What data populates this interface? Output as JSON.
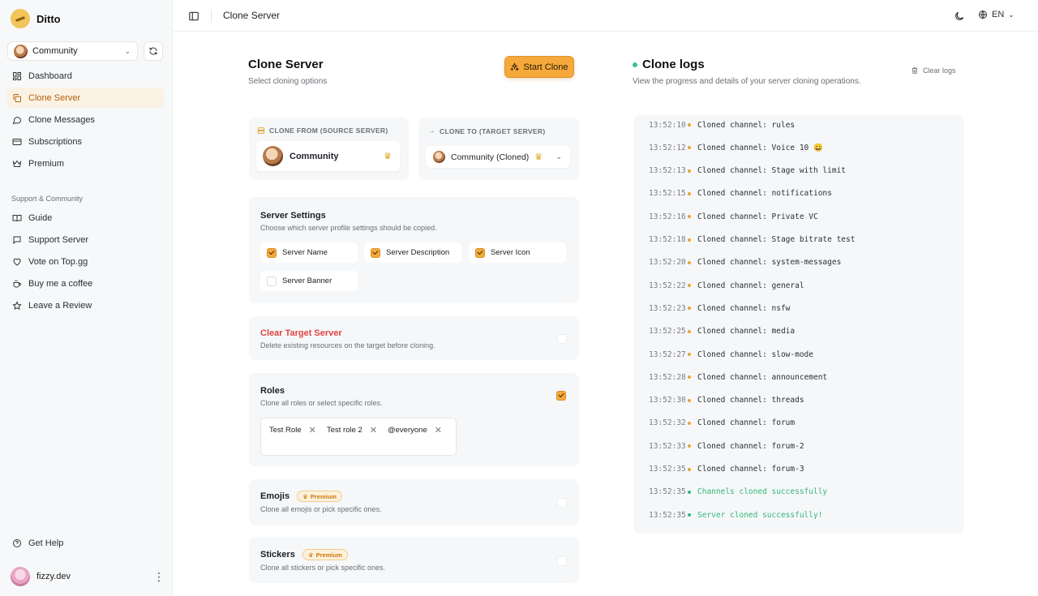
{
  "app": {
    "name": "Ditto"
  },
  "sidebar": {
    "server_selector": {
      "value": "Community"
    },
    "nav": [
      {
        "label": "Dashboard",
        "icon": "dashboard-icon",
        "active": false
      },
      {
        "label": "Clone Server",
        "icon": "copy-icon",
        "active": true
      },
      {
        "label": "Clone Messages",
        "icon": "message-icon",
        "active": false
      },
      {
        "label": "Subscriptions",
        "icon": "card-icon",
        "active": false
      },
      {
        "label": "Premium",
        "icon": "crown-icon",
        "active": false
      }
    ],
    "section_title": "Support & Community",
    "support_nav": [
      {
        "label": "Guide",
        "icon": "book-icon"
      },
      {
        "label": "Support Server",
        "icon": "chat-icon"
      },
      {
        "label": "Vote on Top.gg",
        "icon": "heart-icon"
      },
      {
        "label": "Buy me a coffee",
        "icon": "coffee-icon"
      },
      {
        "label": "Leave a Review",
        "icon": "star-icon"
      }
    ],
    "help": "Get Help",
    "user": {
      "name": "fizzy.dev"
    }
  },
  "topbar": {
    "title": "Clone Server",
    "language": "EN"
  },
  "main": {
    "title": "Clone Server",
    "subtitle": "Select cloning options",
    "start_button": "Start Clone",
    "source": {
      "label": "CLONE FROM (SOURCE SERVER)",
      "server": "Community"
    },
    "target": {
      "label": "CLONE TO (TARGET SERVER)",
      "server": "Community (Cloned)"
    },
    "server_settings": {
      "title": "Server Settings",
      "subtitle": "Choose which server profile settings should be copied.",
      "options": [
        {
          "label": "Server Name",
          "checked": true
        },
        {
          "label": "Server Description",
          "checked": true
        },
        {
          "label": "Server Icon",
          "checked": true
        },
        {
          "label": "Server Banner",
          "checked": false
        }
      ]
    },
    "clear_target": {
      "title": "Clear Target Server",
      "subtitle": "Delete existing resources on the target before cloning.",
      "checked": false
    },
    "roles": {
      "title": "Roles",
      "subtitle": "Clone all roles or select specific roles.",
      "checked": true,
      "chips": [
        "Test Role",
        "Test role 2",
        "@everyone"
      ]
    },
    "emojis": {
      "title": "Emojis",
      "badge": "Premium",
      "subtitle": "Clone all emojis or pick specific ones.",
      "checked": false
    },
    "stickers": {
      "title": "Stickers",
      "badge": "Premium",
      "subtitle": "Clone all stickers or pick specific ones.",
      "checked": false
    }
  },
  "logs": {
    "title": "Clone logs",
    "subtitle": "View the progress and details of your server cloning operations.",
    "clear_label": "Clear logs",
    "entries": [
      {
        "time": "13:52:10",
        "msg": "Cloned channel: rules",
        "status": "info"
      },
      {
        "time": "13:52:12",
        "msg": "Cloned channel: Voice 10 😀",
        "status": "info"
      },
      {
        "time": "13:52:13",
        "msg": "Cloned channel: Stage with limit",
        "status": "info"
      },
      {
        "time": "13:52:15",
        "msg": "Cloned channel: notifications",
        "status": "info"
      },
      {
        "time": "13:52:16",
        "msg": "Cloned channel: Private VC",
        "status": "info"
      },
      {
        "time": "13:52:18",
        "msg": "Cloned channel: Stage bitrate test",
        "status": "info"
      },
      {
        "time": "13:52:20",
        "msg": "Cloned channel: system-messages",
        "status": "info"
      },
      {
        "time": "13:52:22",
        "msg": "Cloned channel: general",
        "status": "info"
      },
      {
        "time": "13:52:23",
        "msg": "Cloned channel: nsfw",
        "status": "info"
      },
      {
        "time": "13:52:25",
        "msg": "Cloned channel: media",
        "status": "info"
      },
      {
        "time": "13:52:27",
        "msg": "Cloned channel: slow-mode",
        "status": "info"
      },
      {
        "time": "13:52:28",
        "msg": "Cloned channel: announcement",
        "status": "info"
      },
      {
        "time": "13:52:30",
        "msg": "Cloned channel: threads",
        "status": "info"
      },
      {
        "time": "13:52:32",
        "msg": "Cloned channel: forum",
        "status": "info"
      },
      {
        "time": "13:52:33",
        "msg": "Cloned channel: forum-2",
        "status": "info"
      },
      {
        "time": "13:52:35",
        "msg": "Cloned channel: forum-3",
        "status": "info"
      },
      {
        "time": "13:52:35",
        "msg": "Channels cloned successfully",
        "status": "success"
      },
      {
        "time": "13:52:35",
        "msg": "Server cloned successfully!",
        "status": "success"
      }
    ]
  },
  "colors": {
    "accent": "#f4a93a",
    "success": "#2fb87a",
    "danger": "#e04545"
  }
}
